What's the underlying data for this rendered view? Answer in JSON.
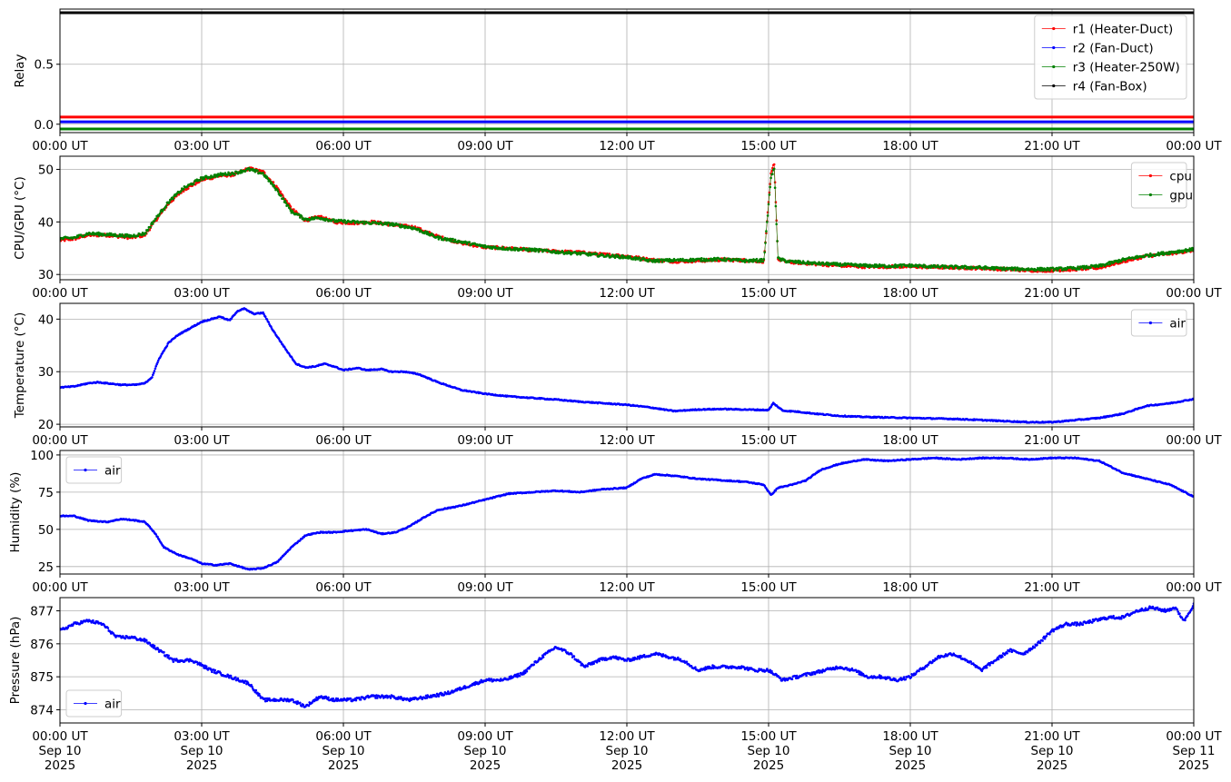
{
  "chart_data": [
    {
      "type": "line",
      "ylabel": "Relay",
      "ylim": [
        -0.07,
        0.96
      ],
      "yticks": [
        {
          "v": 0.0,
          "label": "0.0"
        },
        {
          "v": 0.5,
          "label": "0.5"
        }
      ],
      "x_ticks": [
        "00:00 UT",
        "03:00 UT",
        "06:00 UT",
        "09:00 UT",
        "12:00 UT",
        "15:00 UT",
        "18:00 UT",
        "21:00 UT",
        "00:00 UT"
      ],
      "grid": true,
      "legend": "top-right",
      "series": [
        {
          "name": "r1 (Heater-Duct)",
          "color": "#ff0000",
          "x_hours": [
            0,
            24
          ],
          "y": [
            0.06,
            0.06
          ]
        },
        {
          "name": "r2 (Fan-Duct)",
          "color": "#0000ff",
          "x_hours": [
            0,
            24
          ],
          "y": [
            0.02,
            0.02
          ]
        },
        {
          "name": "r3 (Heater-250W)",
          "color": "#008000",
          "x_hours": [
            0,
            24
          ],
          "y": [
            -0.04,
            -0.04
          ]
        },
        {
          "name": "r4 (Fan-Box)",
          "color": "#000000",
          "x_hours": [
            0,
            24
          ],
          "y": [
            0.93,
            0.93
          ]
        }
      ]
    },
    {
      "type": "line",
      "ylabel": "CPU/GPU (°C)",
      "ylim": [
        29,
        52.5
      ],
      "yticks": [
        {
          "v": 30,
          "label": "30"
        },
        {
          "v": 40,
          "label": "40"
        },
        {
          "v": 50,
          "label": "50"
        }
      ],
      "x_ticks": [
        "00:00 UT",
        "03:00 UT",
        "06:00 UT",
        "09:00 UT",
        "12:00 UT",
        "15:00 UT",
        "18:00 UT",
        "21:00 UT",
        "00:00 UT"
      ],
      "grid": true,
      "legend": "top-right",
      "series": [
        {
          "name": "cpu",
          "color": "#ff0000",
          "x_hours": [
            0,
            0.3,
            0.6,
            1.0,
            1.5,
            1.8,
            2.0,
            2.3,
            2.6,
            3.0,
            3.4,
            3.7,
            4.0,
            4.3,
            4.6,
            4.9,
            5.2,
            5.5,
            5.8,
            6.2,
            6.6,
            7.0,
            7.5,
            8.0,
            8.5,
            9.0,
            9.5,
            10.0,
            10.5,
            11.0,
            11.5,
            12.0,
            12.5,
            13.0,
            13.5,
            14.0,
            14.5,
            14.9,
            15.05,
            15.12,
            15.2,
            15.4,
            16.0,
            16.5,
            17.0,
            17.5,
            18.0,
            18.5,
            19.0,
            19.5,
            20.0,
            20.5,
            21.0,
            21.5,
            22.0,
            22.5,
            23.0,
            23.5,
            24.0
          ],
          "y": [
            36.5,
            36.8,
            37.5,
            37.5,
            37.0,
            37.5,
            40.0,
            43.5,
            46.0,
            48.0,
            48.8,
            49.0,
            50.2,
            49.5,
            46.5,
            42.5,
            40.3,
            41.0,
            40.0,
            39.8,
            40.0,
            39.5,
            39.0,
            37.2,
            36.0,
            35.2,
            35.0,
            34.6,
            34.4,
            34.2,
            33.8,
            33.5,
            32.8,
            32.5,
            32.6,
            32.8,
            32.7,
            32.5,
            49.0,
            51.2,
            32.9,
            32.4,
            32.0,
            31.7,
            31.5,
            31.5,
            31.5,
            31.4,
            31.3,
            31.2,
            31.0,
            30.8,
            30.8,
            31.0,
            31.3,
            32.5,
            33.5,
            34.0,
            34.6
          ]
        },
        {
          "name": "gpu",
          "color": "#008000",
          "x_hours": [
            0,
            0.3,
            0.6,
            1.0,
            1.5,
            1.8,
            2.0,
            2.3,
            2.6,
            3.0,
            3.4,
            3.7,
            4.0,
            4.3,
            4.6,
            4.9,
            5.2,
            5.5,
            5.8,
            6.2,
            6.6,
            7.0,
            7.5,
            8.0,
            8.5,
            9.0,
            9.5,
            10.0,
            10.5,
            11.0,
            11.5,
            12.0,
            12.5,
            13.0,
            13.5,
            14.0,
            14.5,
            14.9,
            15.05,
            15.12,
            15.2,
            15.4,
            16.0,
            16.5,
            17.0,
            17.5,
            18.0,
            18.5,
            19.0,
            19.5,
            20.0,
            20.5,
            21.0,
            21.5,
            22.0,
            22.5,
            23.0,
            23.5,
            24.0
          ],
          "y": [
            36.8,
            37.0,
            37.8,
            37.6,
            37.3,
            37.8,
            40.3,
            43.8,
            46.3,
            48.3,
            49.0,
            49.3,
            50.0,
            49.2,
            46.0,
            42.0,
            40.5,
            40.8,
            40.2,
            40.0,
            39.8,
            39.6,
            38.8,
            37.0,
            36.2,
            35.3,
            34.9,
            34.7,
            34.3,
            34.0,
            33.6,
            33.3,
            32.6,
            32.7,
            32.8,
            32.9,
            32.6,
            32.7,
            48.5,
            50.0,
            33.0,
            32.5,
            32.1,
            31.9,
            31.7,
            31.6,
            31.7,
            31.5,
            31.4,
            31.3,
            31.1,
            31.0,
            31.0,
            31.2,
            31.6,
            32.8,
            33.6,
            34.2,
            34.8
          ]
        }
      ]
    },
    {
      "type": "line",
      "ylabel": "Temperature (°C)",
      "ylim": [
        19.5,
        43
      ],
      "yticks": [
        {
          "v": 20,
          "label": "20"
        },
        {
          "v": 30,
          "label": "30"
        },
        {
          "v": 40,
          "label": "40"
        }
      ],
      "x_ticks": [
        "00:00 UT",
        "03:00 UT",
        "06:00 UT",
        "09:00 UT",
        "12:00 UT",
        "15:00 UT",
        "18:00 UT",
        "21:00 UT",
        "00:00 UT"
      ],
      "grid": true,
      "legend": "top-right",
      "series": [
        {
          "name": "air",
          "color": "#0000ff",
          "x_hours": [
            0,
            0.3,
            0.6,
            0.8,
            1.0,
            1.3,
            1.6,
            1.8,
            1.95,
            2.1,
            2.3,
            2.5,
            2.8,
            3.0,
            3.2,
            3.4,
            3.5,
            3.6,
            3.75,
            3.9,
            4.1,
            4.3,
            4.5,
            4.8,
            5.0,
            5.2,
            5.4,
            5.6,
            5.8,
            6.0,
            6.3,
            6.5,
            6.8,
            7.0,
            7.3,
            7.6,
            8.0,
            8.5,
            9.0,
            9.5,
            10.0,
            10.5,
            11.0,
            11.5,
            12.0,
            12.5,
            13.0,
            13.5,
            14.0,
            14.5,
            15.0,
            15.1,
            15.3,
            15.6,
            16.0,
            16.5,
            17.0,
            17.5,
            18.0,
            18.5,
            19.0,
            19.5,
            20.0,
            20.5,
            21.0,
            21.5,
            22.0,
            22.5,
            23.0,
            23.5,
            24.0
          ],
          "y": [
            27.0,
            27.2,
            27.8,
            28.0,
            27.8,
            27.5,
            27.5,
            27.8,
            29.0,
            32.5,
            35.5,
            37.0,
            38.5,
            39.5,
            40.0,
            40.5,
            40.0,
            39.8,
            41.5,
            42.0,
            41.0,
            41.2,
            38.0,
            34.0,
            31.5,
            30.8,
            31.0,
            31.5,
            31.0,
            30.3,
            30.7,
            30.3,
            30.5,
            30.0,
            30.0,
            29.5,
            28.0,
            26.5,
            25.8,
            25.3,
            25.0,
            24.7,
            24.3,
            24.0,
            23.7,
            23.2,
            22.5,
            22.8,
            22.9,
            22.8,
            22.7,
            24.0,
            22.6,
            22.4,
            22.0,
            21.6,
            21.4,
            21.3,
            21.2,
            21.1,
            21.0,
            20.8,
            20.6,
            20.4,
            20.4,
            20.8,
            21.2,
            22.0,
            23.5,
            24.0,
            24.8
          ]
        }
      ]
    },
    {
      "type": "line",
      "ylabel": "Humidity (%)",
      "ylim": [
        20,
        103
      ],
      "yticks": [
        {
          "v": 25,
          "label": "25"
        },
        {
          "v": 50,
          "label": "50"
        },
        {
          "v": 75,
          "label": "75"
        },
        {
          "v": 100,
          "label": "100"
        }
      ],
      "x_ticks": [
        "00:00 UT",
        "03:00 UT",
        "06:00 UT",
        "09:00 UT",
        "12:00 UT",
        "15:00 UT",
        "18:00 UT",
        "21:00 UT",
        "00:00 UT"
      ],
      "grid": true,
      "legend": "top-left",
      "series": [
        {
          "name": "air",
          "color": "#0000ff",
          "x_hours": [
            0,
            0.3,
            0.6,
            1.0,
            1.3,
            1.6,
            1.8,
            2.0,
            2.2,
            2.5,
            2.8,
            3.0,
            3.3,
            3.6,
            3.8,
            4.0,
            4.3,
            4.6,
            4.9,
            5.2,
            5.5,
            5.8,
            6.1,
            6.5,
            6.8,
            7.1,
            7.4,
            7.7,
            8.0,
            8.5,
            9.0,
            9.5,
            10.0,
            10.5,
            11.0,
            11.5,
            12.0,
            12.3,
            12.6,
            13.0,
            13.5,
            14.0,
            14.5,
            14.9,
            15.05,
            15.2,
            15.5,
            15.8,
            16.1,
            16.5,
            17.0,
            17.5,
            18.0,
            18.5,
            19.0,
            19.5,
            20.0,
            20.5,
            21.0,
            21.5,
            22.0,
            22.5,
            23.0,
            23.5,
            24.0
          ],
          "y": [
            59,
            59,
            56,
            55,
            57,
            56,
            55,
            48,
            38,
            33,
            30,
            27,
            26,
            27,
            25,
            23,
            24,
            28,
            38,
            46,
            48,
            48,
            49,
            50,
            47,
            48,
            52,
            58,
            63,
            66,
            70,
            74,
            75,
            76,
            75,
            77,
            78,
            84,
            87,
            86,
            84,
            83,
            82,
            80,
            73,
            78,
            80,
            83,
            90,
            94,
            97,
            96,
            97,
            98,
            97,
            98,
            98,
            97,
            98,
            98,
            96,
            88,
            84,
            80,
            72
          ]
        }
      ]
    },
    {
      "type": "line",
      "ylabel": "Pressure (hPa)",
      "ylim": [
        873.6,
        877.4
      ],
      "yticks": [
        {
          "v": 874,
          "label": "874"
        },
        {
          "v": 875,
          "label": "875"
        },
        {
          "v": 876,
          "label": "876"
        },
        {
          "v": 877,
          "label": "877"
        }
      ],
      "x_ticks": [
        "00:00 UT",
        "03:00 UT",
        "06:00 UT",
        "09:00 UT",
        "12:00 UT",
        "15:00 UT",
        "18:00 UT",
        "21:00 UT",
        "00:00 UT"
      ],
      "x_ticks_line2": [
        "Sep 10",
        "Sep 10",
        "Sep 10",
        "Sep 10",
        "Sep 10",
        "Sep 10",
        "Sep 10",
        "Sep 10",
        "Sep 11"
      ],
      "x_ticks_line3": [
        "2025",
        "2025",
        "2025",
        "2025",
        "2025",
        "2025",
        "2025",
        "2025",
        "2025"
      ],
      "grid": true,
      "legend": "bottom-left",
      "series": [
        {
          "name": "air",
          "color": "#0000ff",
          "x_hours": [
            0,
            0.3,
            0.6,
            0.9,
            1.2,
            1.5,
            1.8,
            2.1,
            2.4,
            2.8,
            3.2,
            3.6,
            4.0,
            4.3,
            4.6,
            4.9,
            5.2,
            5.5,
            5.8,
            6.2,
            6.6,
            7.0,
            7.4,
            7.8,
            8.2,
            8.6,
            9.0,
            9.4,
            9.8,
            10.2,
            10.5,
            10.8,
            11.1,
            11.4,
            11.7,
            12.0,
            12.3,
            12.6,
            12.9,
            13.2,
            13.5,
            13.8,
            14.1,
            14.4,
            14.7,
            15.0,
            15.3,
            15.6,
            15.9,
            16.2,
            16.5,
            16.8,
            17.1,
            17.4,
            17.7,
            18.0,
            18.3,
            18.6,
            18.9,
            19.2,
            19.5,
            19.8,
            20.1,
            20.4,
            20.7,
            21.0,
            21.3,
            21.6,
            21.9,
            22.2,
            22.5,
            22.8,
            23.1,
            23.4,
            23.6,
            23.8,
            24.0
          ],
          "y": [
            876.4,
            876.6,
            876.7,
            876.6,
            876.2,
            876.2,
            876.1,
            875.8,
            875.5,
            875.5,
            875.2,
            875.0,
            874.8,
            874.3,
            874.3,
            874.3,
            874.1,
            874.4,
            874.3,
            874.3,
            874.4,
            874.4,
            874.3,
            874.4,
            874.5,
            874.7,
            874.9,
            874.9,
            875.1,
            875.6,
            875.9,
            875.7,
            875.3,
            875.5,
            875.6,
            875.5,
            875.6,
            875.7,
            875.6,
            875.5,
            875.2,
            875.3,
            875.3,
            875.3,
            875.2,
            875.2,
            874.9,
            875.0,
            875.1,
            875.2,
            875.3,
            875.2,
            875.0,
            875.0,
            874.9,
            875.0,
            875.3,
            875.6,
            875.7,
            875.5,
            875.2,
            875.5,
            875.8,
            875.7,
            876.0,
            876.4,
            876.6,
            876.6,
            876.7,
            876.8,
            876.8,
            877.0,
            877.1,
            877.0,
            877.1,
            876.7,
            877.2
          ]
        }
      ]
    }
  ]
}
